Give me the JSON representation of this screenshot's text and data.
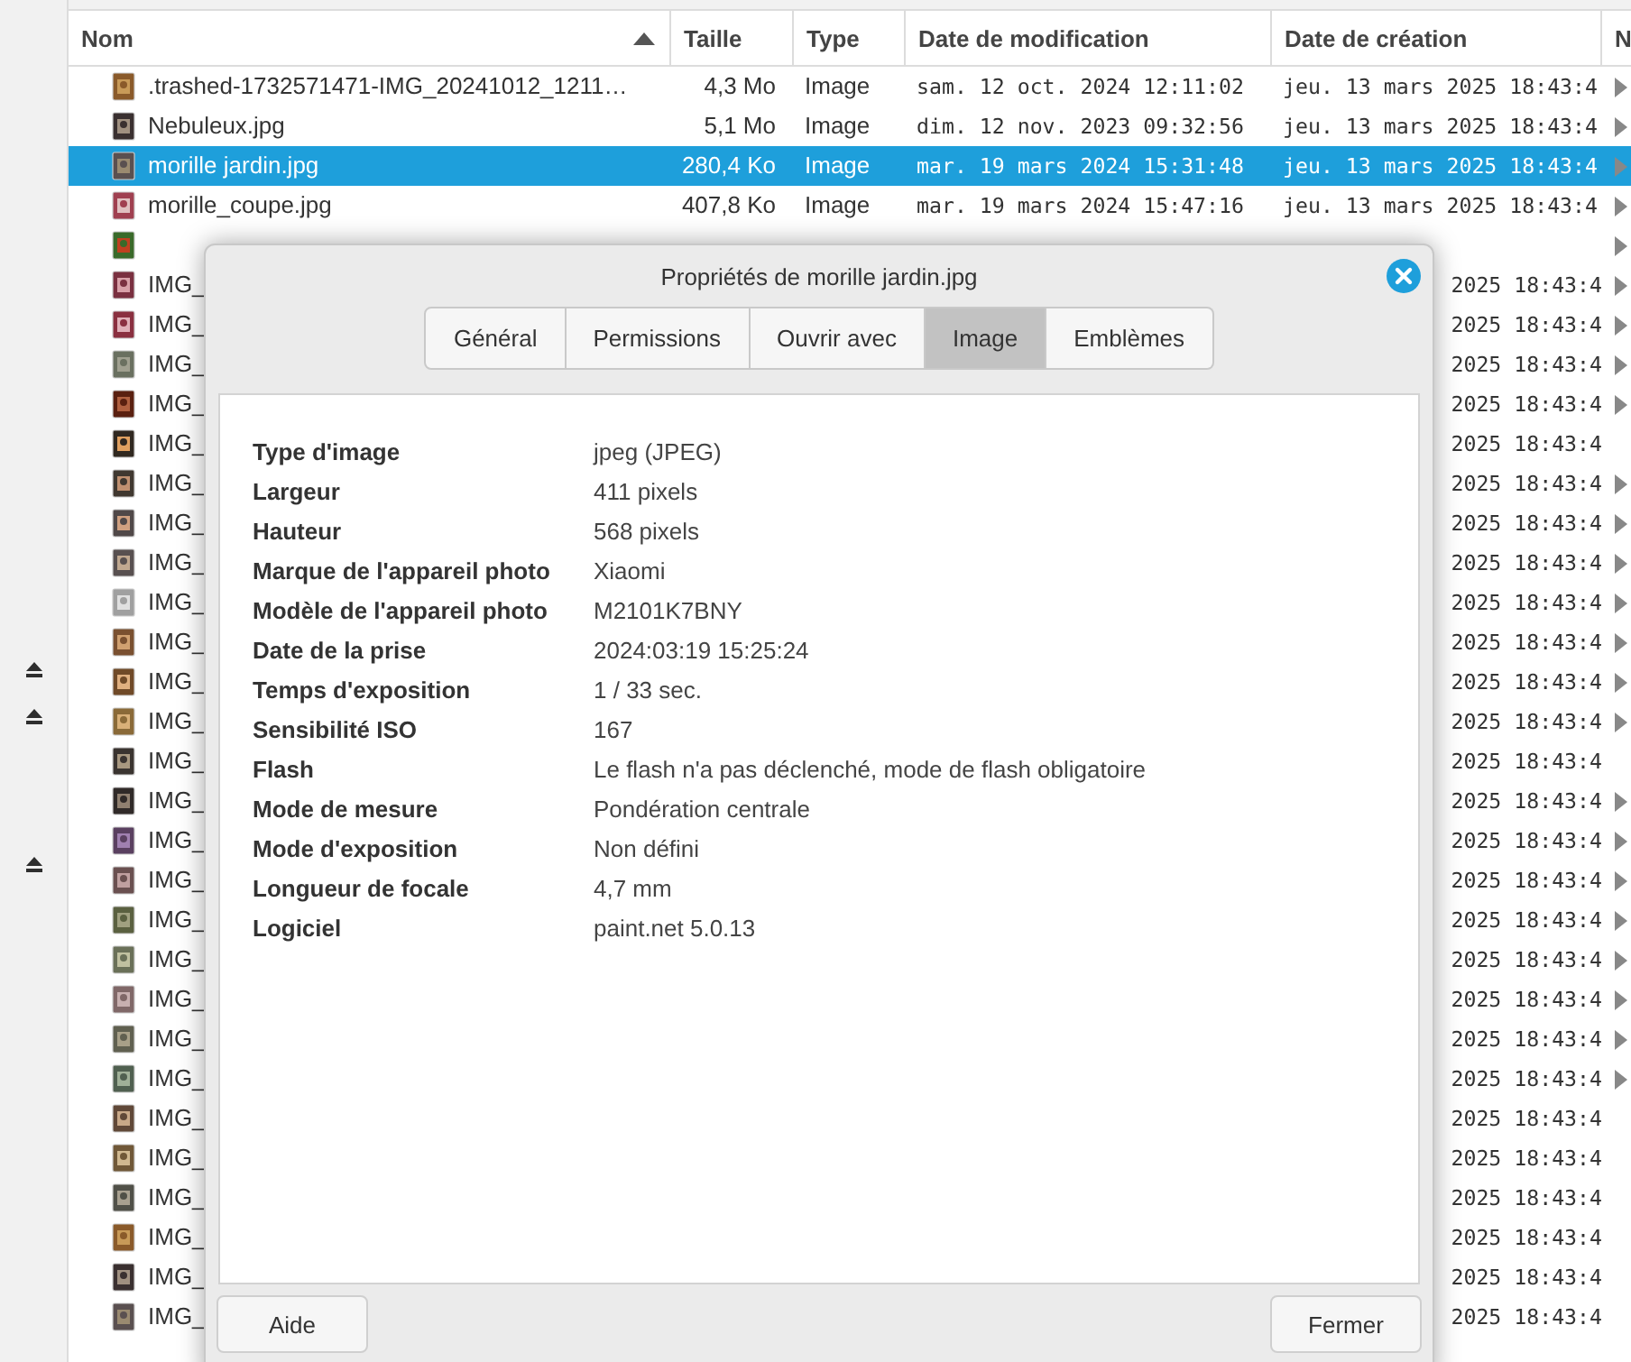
{
  "file_list": {
    "columns": [
      {
        "label": "Nom",
        "sorted": true
      },
      {
        "label": "Taille",
        "sorted": false
      },
      {
        "label": "Type",
        "sorted": false
      },
      {
        "label": "Date de modification",
        "sorted": false
      },
      {
        "label": "Date de création",
        "sorted": false
      },
      {
        "label": "N",
        "sorted": false
      }
    ],
    "rows": [
      {
        "name": ".trashed-1732571471-IMG_20241012_1211…",
        "size": "4,3 Mo",
        "type": "Image",
        "modified": "sam. 12 oct. 2024 12:11:02",
        "created": "jeu. 13 mars 2025 18:43:4",
        "selected": false,
        "expander": true
      },
      {
        "name": "Nebuleux.jpg",
        "size": "5,1 Mo",
        "type": "Image",
        "modified": "dim. 12 nov. 2023 09:32:56",
        "created": "jeu. 13 mars 2025 18:43:4",
        "selected": false,
        "expander": true
      },
      {
        "name": "morille jardin.jpg",
        "size": "280,4 Ko",
        "type": "Image",
        "modified": "mar. 19 mars 2024 15:31:48",
        "created": "jeu. 13 mars 2025 18:43:4",
        "selected": true,
        "expander": true
      },
      {
        "name": "morille_coupe.jpg",
        "size": "407,8 Ko",
        "type": "Image",
        "modified": "mar. 19 mars 2024 15:47:16",
        "created": "jeu. 13 mars 2025 18:43:4",
        "selected": false,
        "expander": true
      },
      {
        "selected": false,
        "expander": true
      },
      {
        "name": "IMG_",
        "created": "2025 18:43:4",
        "selected": false,
        "expander": true
      },
      {
        "name": "IMG_",
        "created": "2025 18:43:4",
        "selected": false,
        "expander": true
      },
      {
        "name": "IMG_",
        "created": "2025 18:43:4",
        "selected": false,
        "expander": true
      },
      {
        "name": "IMG_",
        "created": "2025 18:43:4",
        "selected": false,
        "expander": true
      },
      {
        "name": "IMG_",
        "created": "2025 18:43:4",
        "selected": false,
        "expander": false
      },
      {
        "name": "IMG_",
        "created": "2025 18:43:4",
        "selected": false,
        "expander": true
      },
      {
        "name": "IMG_",
        "created": "2025 18:43:4",
        "selected": false,
        "expander": true
      },
      {
        "name": "IMG_",
        "created": "2025 18:43:4",
        "selected": false,
        "expander": true
      },
      {
        "name": "IMG_",
        "created": "2025 18:43:4",
        "selected": false,
        "expander": true
      },
      {
        "name": "IMG_",
        "created": "2025 18:43:4",
        "selected": false,
        "expander": true
      },
      {
        "name": "IMG_",
        "created": "2025 18:43:4",
        "selected": false,
        "expander": true
      },
      {
        "name": "IMG_",
        "created": "2025 18:43:4",
        "selected": false,
        "expander": true
      },
      {
        "name": "IMG_",
        "created": "2025 18:43:4",
        "selected": false,
        "expander": false
      },
      {
        "name": "IMG_",
        "created": "2025 18:43:4",
        "selected": false,
        "expander": true
      },
      {
        "name": "IMG_",
        "created": "2025 18:43:4",
        "selected": false,
        "expander": true
      },
      {
        "name": "IMG_",
        "created": "2025 18:43:4",
        "selected": false,
        "expander": true
      },
      {
        "name": "IMG_",
        "created": "2025 18:43:4",
        "selected": false,
        "expander": true
      },
      {
        "name": "IMG_",
        "created": "2025 18:43:4",
        "selected": false,
        "expander": true
      },
      {
        "name": "IMG_",
        "created": "2025 18:43:4",
        "selected": false,
        "expander": true
      },
      {
        "name": "IMG_",
        "created": "2025 18:43:4",
        "selected": false,
        "expander": true
      },
      {
        "name": "IMG_",
        "created": "2025 18:43:4",
        "selected": false,
        "expander": true
      },
      {
        "name": "IMG_",
        "created": "2025 18:43:4",
        "selected": false,
        "expander": false
      },
      {
        "name": "IMG_",
        "created": "2025 18:43:4",
        "selected": false,
        "expander": false
      },
      {
        "name": "IMG_",
        "created": "2025 18:43:4",
        "selected": false,
        "expander": false
      },
      {
        "name": "IMG_",
        "created": "2025 18:43:4",
        "selected": false,
        "expander": false
      },
      {
        "name": "IMG_",
        "created": "2025 18:43:4",
        "selected": false,
        "expander": false
      },
      {
        "name": "IMG_",
        "created": "2025 18:43:4",
        "selected": false,
        "expander": false
      }
    ]
  },
  "dialog": {
    "title": "Propriétés de morille jardin.jpg",
    "tabs": [
      {
        "label": "Général",
        "selected": false
      },
      {
        "label": "Permissions",
        "selected": false
      },
      {
        "label": "Ouvrir avec",
        "selected": false
      },
      {
        "label": "Image",
        "selected": true
      },
      {
        "label": "Emblèmes",
        "selected": false
      }
    ],
    "properties": [
      {
        "label": "Type d'image",
        "value": "jpeg (JPEG)"
      },
      {
        "label": "Largeur",
        "value": "411 pixels"
      },
      {
        "label": "Hauteur",
        "value": "568 pixels"
      },
      {
        "label": "Marque de l'appareil photo",
        "value": "Xiaomi"
      },
      {
        "label": "Modèle de l'appareil photo",
        "value": "M2101K7BNY"
      },
      {
        "label": "Date de la prise",
        "value": "2024:03:19 15:25:24"
      },
      {
        "label": "Temps d'exposition",
        "value": "1 / 33 sec."
      },
      {
        "label": "Sensibilité ISO",
        "value": "167"
      },
      {
        "label": "Flash",
        "value": "Le flash n'a pas déclenché, mode de flash obligatoire"
      },
      {
        "label": "Mode de mesure",
        "value": "Pondération centrale"
      },
      {
        "label": "Mode d'exposition",
        "value": "Non défini"
      },
      {
        "label": "Longueur de focale",
        "value": "4,7 mm"
      },
      {
        "label": "Logiciel",
        "value": "paint.net 5.0.13"
      }
    ],
    "buttons": [
      "Aide",
      "Fermer"
    ]
  }
}
